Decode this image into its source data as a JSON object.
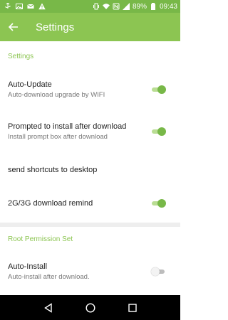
{
  "status_bar": {
    "battery": "89%",
    "time": "09:43",
    "left_icons": [
      "usb-icon",
      "image-icon",
      "mail-icon",
      "warning-icon"
    ],
    "right_icons": [
      "vibrate-icon",
      "wifi-icon",
      "nfc-icon",
      "signal-icon",
      "battery-icon"
    ]
  },
  "app_bar": {
    "title": "Settings",
    "back_icon": "arrow-left-icon"
  },
  "sections": [
    {
      "header": "Settings"
    },
    {
      "header": "Root Permission Set"
    }
  ],
  "settings": {
    "auto_update": {
      "title": "Auto-Update",
      "subtitle": "Auto-download upgrade by WIFI",
      "enabled": true
    },
    "prompt_install": {
      "title": "Prompted to install after download",
      "subtitle": "Install prompt box after download",
      "enabled": true
    },
    "shortcuts": {
      "title": "send shortcuts to desktop"
    },
    "remind_2g3g": {
      "title": "2G/3G download remind",
      "enabled": true
    },
    "auto_install": {
      "title": "Auto-Install",
      "subtitle": "Auto-install after download.",
      "enabled": false
    }
  },
  "colors": {
    "accent": "#8cc552",
    "status_bar": "#78b848",
    "toggle_on": "#78b848"
  },
  "nav_bar": {
    "buttons": [
      "back-triangle-icon",
      "home-circle-icon",
      "recents-square-icon"
    ]
  }
}
